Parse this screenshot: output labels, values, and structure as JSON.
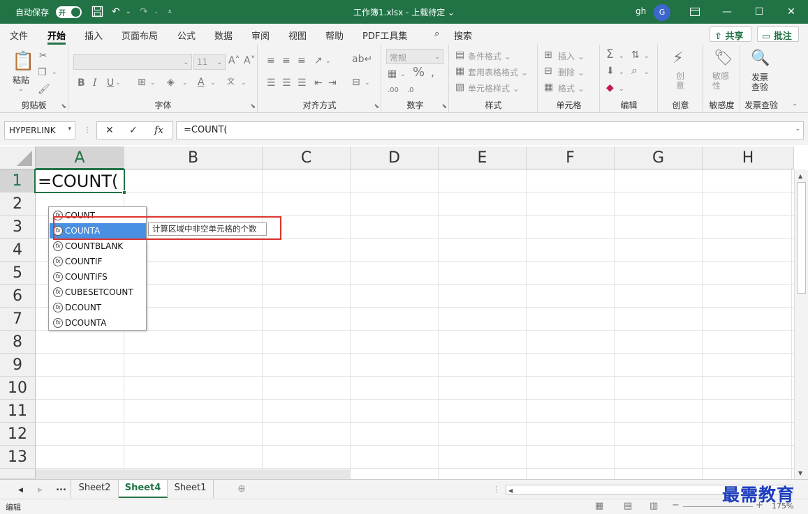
{
  "titlebar": {
    "autosave_label": "自动保存",
    "autosave_state": "开",
    "doc_title": "工作簿1.xlsx - 上载待定 ⌄",
    "user": "gh",
    "avatar_initial": "G"
  },
  "menu": {
    "tabs": [
      "文件",
      "开始",
      "插入",
      "页面布局",
      "公式",
      "数据",
      "审阅",
      "视图",
      "帮助",
      "PDF工具集"
    ],
    "active_tab": "开始",
    "search_label": "搜索",
    "share_label": "共享",
    "comments_label": "批注"
  },
  "ribbon": {
    "clipboard": {
      "label": "剪贴板",
      "paste": "粘贴"
    },
    "font": {
      "label": "字体",
      "size": "11"
    },
    "alignment": {
      "label": "对齐方式"
    },
    "number": {
      "label": "数字",
      "format": "常规"
    },
    "styles": {
      "label": "样式",
      "items": [
        "条件格式 ⌄",
        "套用表格格式 ⌄",
        "单元格样式 ⌄"
      ]
    },
    "cells": {
      "label": "单元格",
      "items": [
        "插入 ⌄",
        "删除 ⌄",
        "格式 ⌄"
      ]
    },
    "editing": {
      "label": "编辑"
    },
    "ideas": {
      "label": "创意",
      "btn": "创意"
    },
    "sensitivity": {
      "label": "敏感度",
      "btn": "敏感性"
    },
    "invoice": {
      "label": "发票查验",
      "btn": "发票查验"
    }
  },
  "formula_bar": {
    "name_box": "HYPERLINK",
    "formula": "=COUNT("
  },
  "sheet": {
    "columns": [
      "A",
      "B",
      "C",
      "D",
      "E",
      "F",
      "G",
      "H"
    ],
    "rows": [
      "1",
      "2",
      "3",
      "4",
      "5",
      "6",
      "7",
      "8",
      "9",
      "10",
      "11",
      "12",
      "13"
    ],
    "active_cell_value": "=COUNT("
  },
  "autocomplete": {
    "items": [
      "COUNT",
      "COUNTA",
      "COUNTBLANK",
      "COUNTIF",
      "COUNTIFS",
      "CUBESETCOUNT",
      "DCOUNT",
      "DCOUNTA"
    ],
    "selected_index": 1,
    "tooltip": "计算区域中非空单元格的个数"
  },
  "sheet_tabs": {
    "more": "...",
    "tabs": [
      "Sheet2",
      "Sheet4",
      "Sheet1"
    ],
    "active": "Sheet4"
  },
  "status": {
    "mode": "编辑",
    "zoom": "175%"
  },
  "watermark": "最需教育",
  "colors": {
    "accent": "#217346",
    "highlight": "#4a90e2",
    "annotation": "#e0332f"
  }
}
